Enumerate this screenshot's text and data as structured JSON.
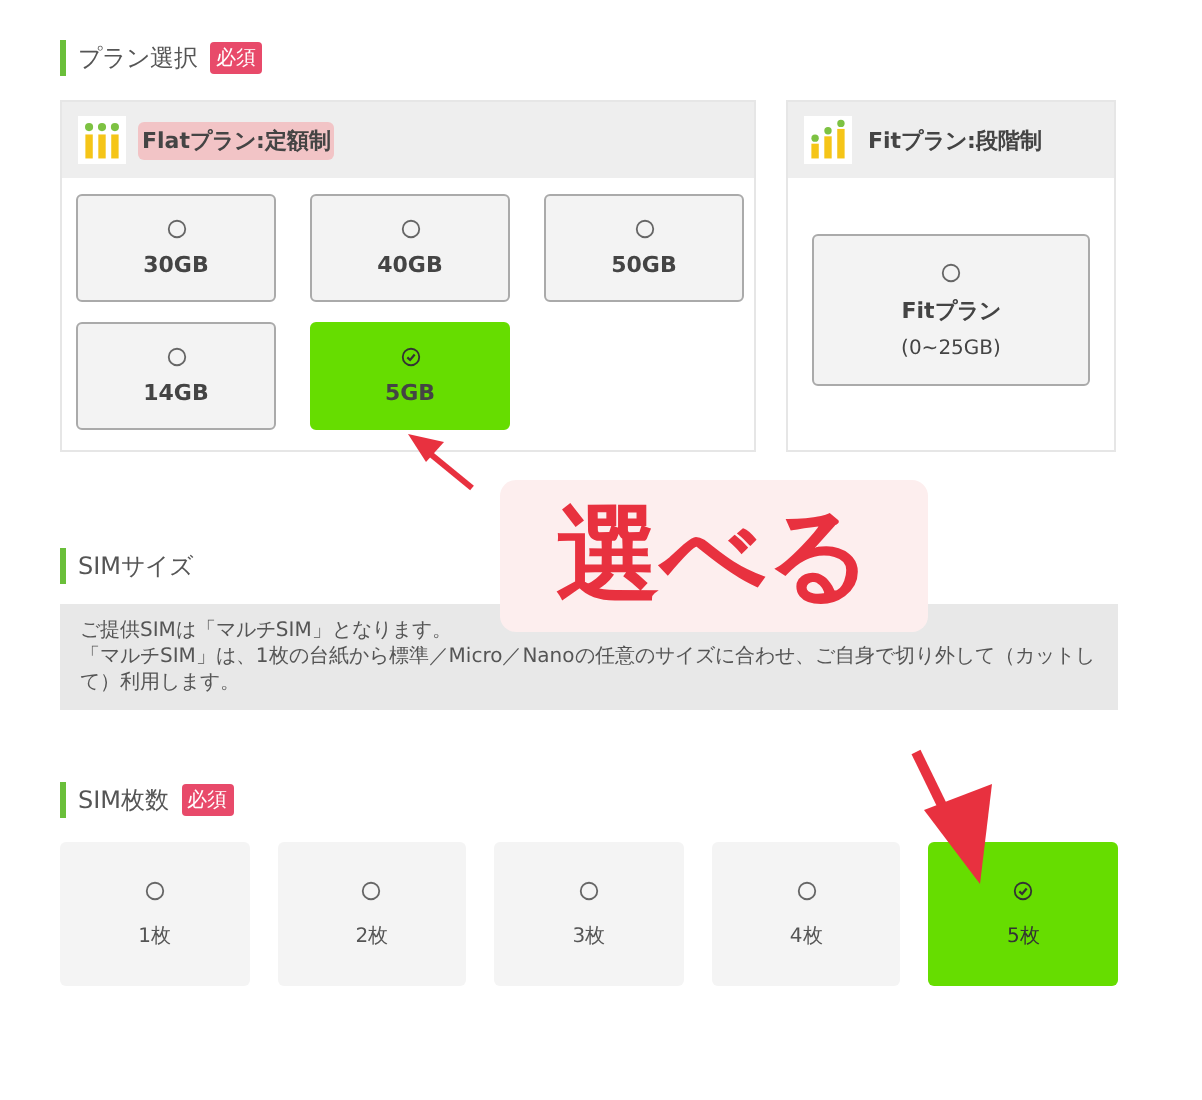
{
  "plan_section": {
    "title": "プラン選択",
    "badge": "必須",
    "plans": [
      {
        "title": "Flatプラン:定額制",
        "highlighted": true,
        "kind": "flat",
        "options": [
          {
            "label": "30GB",
            "selected": false
          },
          {
            "label": "40GB",
            "selected": false
          },
          {
            "label": "50GB",
            "selected": false
          },
          {
            "label": "14GB",
            "selected": false
          },
          {
            "label": "5GB",
            "selected": true
          }
        ]
      },
      {
        "title": "Fitプラン:段階制",
        "highlighted": false,
        "kind": "fit",
        "options": [
          {
            "label": "Fitプラン",
            "sublabel": "(0~25GB)",
            "selected": false
          }
        ]
      }
    ]
  },
  "sim_size_section": {
    "title": "SIMサイズ",
    "note": [
      "ご提供SIMは「マルチSIM」となります。",
      "「マルチSIM」は、1枚の台紙から標準／Micro／Nanoの任意のサイズに合わせ、ご自身で切り外して（カットして）利用します。"
    ]
  },
  "sim_count_section": {
    "title": "SIM枚数",
    "badge": "必須",
    "options": [
      {
        "label": "1枚",
        "selected": false
      },
      {
        "label": "2枚",
        "selected": false
      },
      {
        "label": "3枚",
        "selected": false
      },
      {
        "label": "4枚",
        "selected": false
      },
      {
        "label": "5枚",
        "selected": true
      }
    ]
  },
  "callout": {
    "text": "選べる"
  }
}
